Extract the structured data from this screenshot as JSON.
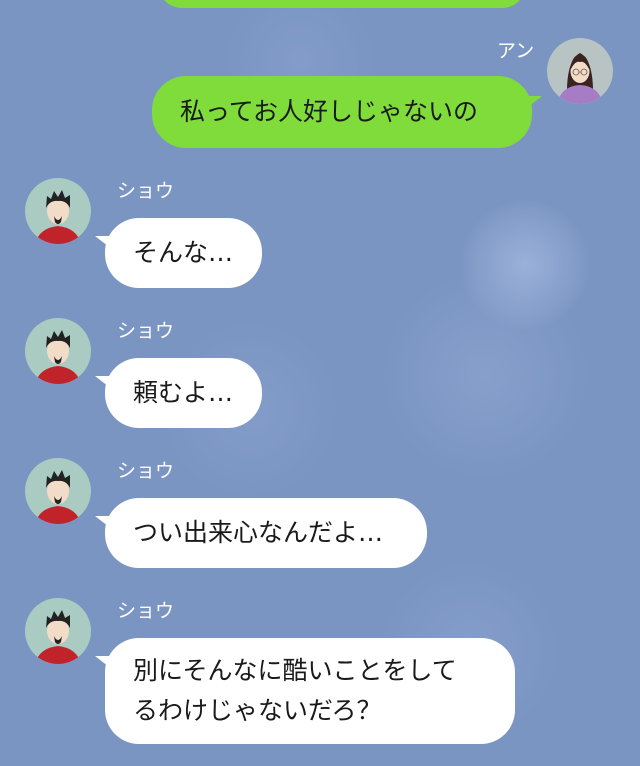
{
  "chat": {
    "messages": [
      {
        "sender": "アン",
        "side": "right",
        "text": "私ってお人好しじゃないの"
      },
      {
        "sender": "ショウ",
        "side": "left",
        "text": "そんな…"
      },
      {
        "sender": "ショウ",
        "side": "left",
        "text": "頼むよ…"
      },
      {
        "sender": "ショウ",
        "side": "left",
        "text": "つい出来心なんだよ…"
      },
      {
        "sender": "ショウ",
        "side": "left",
        "lines": [
          "別にそんなに酷いことをして",
          "るわけじゃないだろ？"
        ]
      }
    ]
  },
  "colors": {
    "background": "#7b95c3",
    "sent_bubble": "#7fdc3a",
    "received_bubble": "#ffffff",
    "name_text": "#ffffff"
  },
  "icons": {
    "avatar_an": "woman-avatar-icon",
    "avatar_shou": "man-avatar-icon"
  }
}
